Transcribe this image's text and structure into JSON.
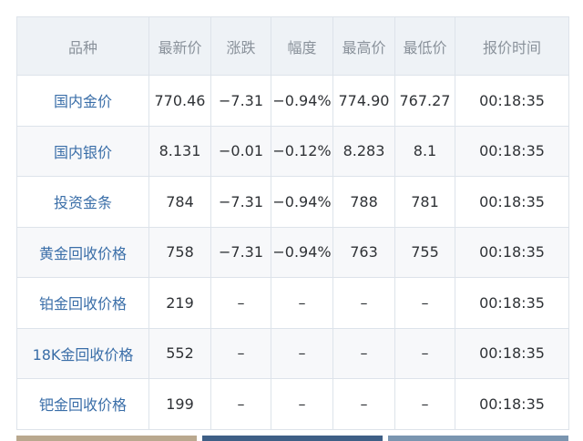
{
  "table": {
    "headers": [
      "品种",
      "最新价",
      "涨跌",
      "幅度",
      "最高价",
      "最低价",
      "报价时间"
    ],
    "rows": [
      [
        "国内金价",
        "770.46",
        "−7.31",
        "−0.94%",
        "774.90",
        "767.27",
        "00:18:35"
      ],
      [
        "国内银价",
        "8.131",
        "−0.01",
        "−0.12%",
        "8.283",
        "8.1",
        "00:18:35"
      ],
      [
        "投资金条",
        "784",
        "−7.31",
        "−0.94%",
        "788",
        "781",
        "00:18:35"
      ],
      [
        "黄金回收价格",
        "758",
        "−7.31",
        "−0.94%",
        "763",
        "755",
        "00:18:35"
      ],
      [
        "铂金回收价格",
        "219",
        "–",
        "–",
        "–",
        "–",
        "00:18:35"
      ],
      [
        "18K金回收价格",
        "552",
        "–",
        "–",
        "–",
        "–",
        "00:18:35"
      ],
      [
        "钯金回收价格",
        "199",
        "–",
        "–",
        "–",
        "–",
        "00:18:35"
      ]
    ]
  },
  "colors": {
    "header_bg": "#eef2f6",
    "header_text": "#8a929b",
    "name_text": "#3a6ea8",
    "border": "#dde3ea",
    "strip": [
      "#b9a88e",
      "#3e5f86",
      "#7a95b0"
    ]
  }
}
